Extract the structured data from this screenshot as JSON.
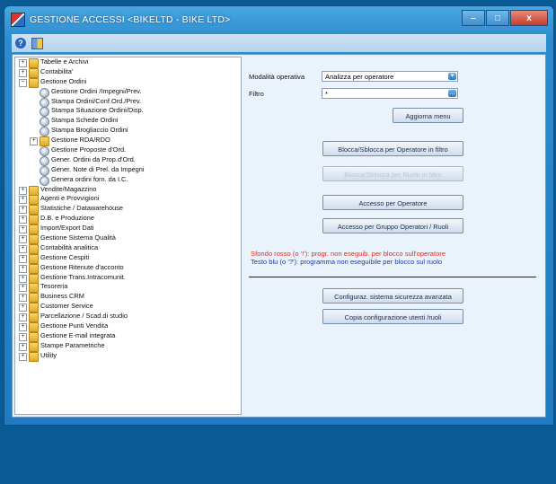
{
  "window": {
    "title": "GESTIONE ACCESSI <BIKELTD - BIKE LTD>",
    "controls": [
      "–",
      "□",
      "x"
    ]
  },
  "toolbar": {
    "help_symbol": "?"
  },
  "tree": [
    {
      "label": "Tabelle e Archivi",
      "level": 0,
      "type": "folder",
      "expanded": false
    },
    {
      "label": "Contabilita'",
      "level": 0,
      "type": "folder",
      "expanded": false
    },
    {
      "label": "Gestione Ordini",
      "level": 0,
      "type": "folder",
      "expanded": true
    },
    {
      "label": "Gestione Ordini /Impegni/Prev.",
      "level": 1,
      "type": "program"
    },
    {
      "label": "Stampa Ordini/Conf.Ord./Prev.",
      "level": 1,
      "type": "program"
    },
    {
      "label": "Stampa Situazione Ordini/Disp.",
      "level": 1,
      "type": "program"
    },
    {
      "label": "Stampa Schede Ordini",
      "level": 1,
      "type": "program"
    },
    {
      "label": "Stampa Brogliaccio Ordini",
      "level": 1,
      "type": "program"
    },
    {
      "label": "Gestione RDA/RDO",
      "level": 1,
      "type": "folder",
      "expanded": false
    },
    {
      "label": "Gestione Proposte d'Ord.",
      "level": 1,
      "type": "program"
    },
    {
      "label": "Gener. Ordini da Prop.d'Ord.",
      "level": 1,
      "type": "program"
    },
    {
      "label": "Gener. Note di Prel. da Impegni",
      "level": 1,
      "type": "program"
    },
    {
      "label": "Genera ordini forn. da I.C.",
      "level": 1,
      "type": "program"
    },
    {
      "label": "Vendite/Magazzino",
      "level": 0,
      "type": "folder",
      "expanded": false
    },
    {
      "label": "Agenti e Provvigioni",
      "level": 0,
      "type": "folder",
      "expanded": false
    },
    {
      "label": "Statistiche / Datawarehouse",
      "level": 0,
      "type": "folder",
      "expanded": false
    },
    {
      "label": "D.B. e Produzione",
      "level": 0,
      "type": "folder",
      "expanded": false
    },
    {
      "label": "Import/Export Dati",
      "level": 0,
      "type": "folder",
      "expanded": false
    },
    {
      "label": "Gestione Sistema Qualità",
      "level": 0,
      "type": "folder",
      "expanded": false
    },
    {
      "label": "Contabilità analitica",
      "level": 0,
      "type": "folder",
      "expanded": false
    },
    {
      "label": "Gestione Cespiti",
      "level": 0,
      "type": "folder",
      "expanded": false
    },
    {
      "label": "Gestione Ritenute d'acconto",
      "level": 0,
      "type": "folder",
      "expanded": false
    },
    {
      "label": "Gestione Trans.Intracomunit.",
      "level": 0,
      "type": "folder",
      "expanded": false
    },
    {
      "label": "Tesoreria",
      "level": 0,
      "type": "folder",
      "expanded": false
    },
    {
      "label": "Business CRM",
      "level": 0,
      "type": "folder",
      "expanded": false
    },
    {
      "label": "Customer Service",
      "level": 0,
      "type": "folder",
      "expanded": false
    },
    {
      "label": "Parcellazione / Scad.di studio",
      "level": 0,
      "type": "folder",
      "expanded": false
    },
    {
      "label": "Gestione Punti Vendita",
      "level": 0,
      "type": "folder",
      "expanded": false
    },
    {
      "label": "Gestione E-mail integrata",
      "level": 0,
      "type": "folder",
      "expanded": false
    },
    {
      "label": "Stampe Parametriche",
      "level": 0,
      "type": "folder",
      "expanded": false
    },
    {
      "label": "Utility",
      "level": 0,
      "type": "folder",
      "expanded": false
    }
  ],
  "form": {
    "mode_label": "Modalità operativa",
    "mode_value": "Analizza per operatore",
    "filter_label": "Filtro",
    "filter_value": "*",
    "refresh_button": "Aggiorna menu"
  },
  "buttons": {
    "block_operator": "Blocca/Sblocca per Operatore in filtro",
    "block_role": "Blocca/Sblocca per Ruolo in filtro",
    "access_operator": "Accesso per Operatore",
    "access_group": "Accesso per Gruppo Operatori / Ruoli",
    "config_security": "Configuraz. sistema sicurezza avanzata",
    "copy_config": "Copia configurazione utenti /ruoli"
  },
  "notes": {
    "red": "Sfondo rosso (o '!'): progr. non eseguib. per blocco sull'operatore",
    "blue": "Testo blu (o '?'): programma non eseguibile per blocco sul ruolo"
  },
  "colors": {
    "red_note": "#e03020",
    "blue_note": "#1a3fb0",
    "window_frame": "#2a8ccf",
    "desktop": "#0a5a96"
  }
}
